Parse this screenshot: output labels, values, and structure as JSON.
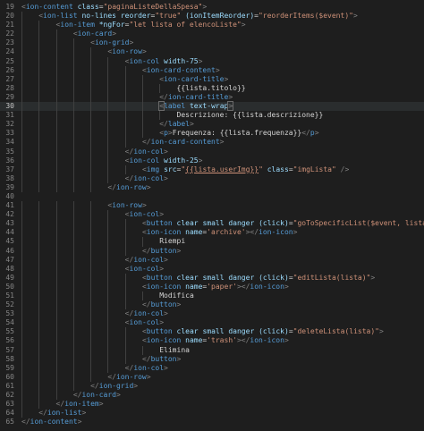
{
  "editor": {
    "language": "html",
    "active_line": 30,
    "colors": {
      "background": "#1e1e1e",
      "line_number": "#858585",
      "tag": "#569cd6",
      "attribute": "#9cdcfe",
      "string": "#ce9178",
      "text": "#d4d4d4",
      "punctuation": "#808080"
    },
    "lines": [
      {
        "n": "19",
        "indent": 0,
        "tokens": [
          [
            "p",
            "<"
          ],
          [
            "g",
            "ion-content"
          ],
          [
            "t",
            " "
          ],
          [
            "a",
            "class"
          ],
          [
            "t",
            "="
          ],
          [
            "s",
            "\"paginaListeDellaSpesa\""
          ],
          [
            "p",
            ">"
          ]
        ]
      },
      {
        "n": "20",
        "indent": 1,
        "tokens": [
          [
            "p",
            "<"
          ],
          [
            "g",
            "ion-list"
          ],
          [
            "t",
            " "
          ],
          [
            "a",
            "no-lines"
          ],
          [
            "t",
            " "
          ],
          [
            "a",
            "reorder"
          ],
          [
            "t",
            "="
          ],
          [
            "s",
            "\"true\""
          ],
          [
            "t",
            " "
          ],
          [
            "a",
            "(ionItemReorder)"
          ],
          [
            "t",
            "="
          ],
          [
            "s",
            "\"reorderItems($event)\""
          ],
          [
            "p",
            ">"
          ]
        ]
      },
      {
        "n": "21",
        "indent": 2,
        "tokens": [
          [
            "p",
            "<"
          ],
          [
            "g",
            "ion-item"
          ],
          [
            "t",
            " "
          ],
          [
            "a",
            "*ngFor"
          ],
          [
            "t",
            "="
          ],
          [
            "s",
            "\"let lista of elencoListe\""
          ],
          [
            "p",
            ">"
          ]
        ]
      },
      {
        "n": "22",
        "indent": 3,
        "tokens": [
          [
            "p",
            "<"
          ],
          [
            "g",
            "ion-card"
          ],
          [
            "p",
            ">"
          ]
        ]
      },
      {
        "n": "23",
        "indent": 4,
        "tokens": [
          [
            "p",
            "<"
          ],
          [
            "g",
            "ion-grid"
          ],
          [
            "p",
            ">"
          ]
        ]
      },
      {
        "n": "24",
        "indent": 5,
        "tokens": [
          [
            "p",
            "<"
          ],
          [
            "g",
            "ion-row"
          ],
          [
            "p",
            ">"
          ]
        ]
      },
      {
        "n": "25",
        "indent": 6,
        "tokens": [
          [
            "p",
            "<"
          ],
          [
            "g",
            "ion-col"
          ],
          [
            "t",
            " "
          ],
          [
            "a",
            "width-75"
          ],
          [
            "p",
            ">"
          ]
        ]
      },
      {
        "n": "26",
        "indent": 7,
        "tokens": [
          [
            "p",
            "<"
          ],
          [
            "g",
            "ion-card-content"
          ],
          [
            "p",
            ">"
          ]
        ]
      },
      {
        "n": "27",
        "indent": 8,
        "tokens": [
          [
            "p",
            "<"
          ],
          [
            "g",
            "ion-card-title"
          ],
          [
            "p",
            ">"
          ]
        ]
      },
      {
        "n": "28",
        "indent": 9,
        "tokens": [
          [
            "t",
            "{{lista.titolo}}"
          ]
        ]
      },
      {
        "n": "29",
        "indent": 8,
        "tokens": [
          [
            "p",
            "</"
          ],
          [
            "g",
            "ion-card-title"
          ],
          [
            "p",
            ">"
          ]
        ]
      },
      {
        "n": "30",
        "indent": 8,
        "tokens": [
          [
            "ph",
            "<"
          ],
          [
            "g",
            "label"
          ],
          [
            "t",
            " "
          ],
          [
            "a",
            "text-wrap"
          ],
          [
            "ph",
            ">"
          ]
        ]
      },
      {
        "n": "31",
        "indent": 9,
        "tokens": [
          [
            "t",
            "Descrizione: {{lista.descrizione}}"
          ]
        ]
      },
      {
        "n": "32",
        "indent": 8,
        "tokens": [
          [
            "p",
            "</"
          ],
          [
            "g",
            "label"
          ],
          [
            "p",
            ">"
          ]
        ]
      },
      {
        "n": "33",
        "indent": 8,
        "tokens": [
          [
            "p",
            "<"
          ],
          [
            "g",
            "p"
          ],
          [
            "p",
            ">"
          ],
          [
            "t",
            "Frequenza: {{lista.frequenza}}"
          ],
          [
            "p",
            "</"
          ],
          [
            "g",
            "p"
          ],
          [
            "p",
            ">"
          ]
        ]
      },
      {
        "n": "34",
        "indent": 7,
        "tokens": [
          [
            "p",
            "</"
          ],
          [
            "g",
            "ion-card-content"
          ],
          [
            "p",
            ">"
          ]
        ]
      },
      {
        "n": "35",
        "indent": 6,
        "tokens": [
          [
            "p",
            "</"
          ],
          [
            "g",
            "ion-col"
          ],
          [
            "p",
            ">"
          ]
        ]
      },
      {
        "n": "36",
        "indent": 6,
        "tokens": [
          [
            "p",
            "<"
          ],
          [
            "g",
            "ion-col"
          ],
          [
            "t",
            " "
          ],
          [
            "a",
            "width-25"
          ],
          [
            "p",
            ">"
          ]
        ]
      },
      {
        "n": "37",
        "indent": 7,
        "tokens": [
          [
            "p",
            "<"
          ],
          [
            "g",
            "img"
          ],
          [
            "t",
            " "
          ],
          [
            "a",
            "src"
          ],
          [
            "t",
            "="
          ],
          [
            "s",
            "\""
          ],
          [
            "l",
            "{{lista.userImg}}"
          ],
          [
            "s",
            "\""
          ],
          [
            "t",
            " "
          ],
          [
            "a",
            "class"
          ],
          [
            "t",
            "="
          ],
          [
            "s",
            "\"imgLista\""
          ],
          [
            "t",
            " "
          ],
          [
            "p",
            "/>"
          ]
        ]
      },
      {
        "n": "38",
        "indent": 6,
        "tokens": [
          [
            "p",
            "</"
          ],
          [
            "g",
            "ion-col"
          ],
          [
            "p",
            ">"
          ]
        ]
      },
      {
        "n": "39",
        "indent": 5,
        "tokens": [
          [
            "p",
            "</"
          ],
          [
            "g",
            "ion-row"
          ],
          [
            "p",
            ">"
          ]
        ]
      },
      {
        "n": "40",
        "indent": 0,
        "tokens": []
      },
      {
        "n": "41",
        "indent": 5,
        "tokens": [
          [
            "p",
            "<"
          ],
          [
            "g",
            "ion-row"
          ],
          [
            "p",
            ">"
          ]
        ]
      },
      {
        "n": "42",
        "indent": 6,
        "tokens": [
          [
            "p",
            "<"
          ],
          [
            "g",
            "ion-col"
          ],
          [
            "p",
            ">"
          ]
        ]
      },
      {
        "n": "43",
        "indent": 7,
        "tokens": [
          [
            "p",
            "<"
          ],
          [
            "g",
            "button"
          ],
          [
            "t",
            " "
          ],
          [
            "a",
            "clear"
          ],
          [
            "t",
            " "
          ],
          [
            "a",
            "small"
          ],
          [
            "t",
            " "
          ],
          [
            "a",
            "danger"
          ],
          [
            "t",
            " "
          ],
          [
            "a",
            "(click)"
          ],
          [
            "t",
            "="
          ],
          [
            "s",
            "\"goToSpecificList($event, lista.titolo)\""
          ],
          [
            "p",
            ">"
          ]
        ]
      },
      {
        "n": "44",
        "indent": 7,
        "tokens": [
          [
            "p",
            "<"
          ],
          [
            "g",
            "ion-icon"
          ],
          [
            "t",
            " "
          ],
          [
            "a",
            "name"
          ],
          [
            "t",
            "="
          ],
          [
            "s",
            "'archive'"
          ],
          [
            "p",
            "></"
          ],
          [
            "g",
            "ion-icon"
          ],
          [
            "p",
            ">"
          ]
        ]
      },
      {
        "n": "45",
        "indent": 8,
        "tokens": [
          [
            "t",
            "Riempi"
          ]
        ]
      },
      {
        "n": "46",
        "indent": 7,
        "tokens": [
          [
            "p",
            "</"
          ],
          [
            "g",
            "button"
          ],
          [
            "p",
            ">"
          ]
        ]
      },
      {
        "n": "47",
        "indent": 6,
        "tokens": [
          [
            "p",
            "</"
          ],
          [
            "g",
            "ion-col"
          ],
          [
            "p",
            ">"
          ]
        ]
      },
      {
        "n": "48",
        "indent": 6,
        "tokens": [
          [
            "p",
            "<"
          ],
          [
            "g",
            "ion-col"
          ],
          [
            "p",
            ">"
          ]
        ]
      },
      {
        "n": "49",
        "indent": 7,
        "tokens": [
          [
            "p",
            "<"
          ],
          [
            "g",
            "button"
          ],
          [
            "t",
            " "
          ],
          [
            "a",
            "clear"
          ],
          [
            "t",
            " "
          ],
          [
            "a",
            "small"
          ],
          [
            "t",
            " "
          ],
          [
            "a",
            "danger"
          ],
          [
            "t",
            " "
          ],
          [
            "a",
            "(click)"
          ],
          [
            "t",
            "="
          ],
          [
            "s",
            "\"editLista(lista)\""
          ],
          [
            "p",
            ">"
          ]
        ]
      },
      {
        "n": "50",
        "indent": 7,
        "tokens": [
          [
            "p",
            "<"
          ],
          [
            "g",
            "ion-icon"
          ],
          [
            "t",
            " "
          ],
          [
            "a",
            "name"
          ],
          [
            "t",
            "="
          ],
          [
            "s",
            "'paper'"
          ],
          [
            "p",
            "></"
          ],
          [
            "g",
            "ion-icon"
          ],
          [
            "p",
            ">"
          ]
        ]
      },
      {
        "n": "51",
        "indent": 8,
        "tokens": [
          [
            "t",
            "Modifica"
          ]
        ]
      },
      {
        "n": "52",
        "indent": 7,
        "tokens": [
          [
            "p",
            "</"
          ],
          [
            "g",
            "button"
          ],
          [
            "p",
            ">"
          ]
        ]
      },
      {
        "n": "53",
        "indent": 6,
        "tokens": [
          [
            "p",
            "</"
          ],
          [
            "g",
            "ion-col"
          ],
          [
            "p",
            ">"
          ]
        ]
      },
      {
        "n": "54",
        "indent": 6,
        "tokens": [
          [
            "p",
            "<"
          ],
          [
            "g",
            "ion-col"
          ],
          [
            "p",
            ">"
          ]
        ]
      },
      {
        "n": "55",
        "indent": 7,
        "tokens": [
          [
            "p",
            "<"
          ],
          [
            "g",
            "button"
          ],
          [
            "t",
            " "
          ],
          [
            "a",
            "clear"
          ],
          [
            "t",
            " "
          ],
          [
            "a",
            "small"
          ],
          [
            "t",
            " "
          ],
          [
            "a",
            "danger"
          ],
          [
            "t",
            " "
          ],
          [
            "a",
            "(click)"
          ],
          [
            "t",
            "="
          ],
          [
            "s",
            "\"deleteLista(lista)\""
          ],
          [
            "p",
            ">"
          ]
        ]
      },
      {
        "n": "56",
        "indent": 7,
        "tokens": [
          [
            "p",
            "<"
          ],
          [
            "g",
            "ion-icon"
          ],
          [
            "t",
            " "
          ],
          [
            "a",
            "name"
          ],
          [
            "t",
            "="
          ],
          [
            "s",
            "'trash'"
          ],
          [
            "p",
            "></"
          ],
          [
            "g",
            "ion-icon"
          ],
          [
            "p",
            ">"
          ]
        ]
      },
      {
        "n": "57",
        "indent": 8,
        "tokens": [
          [
            "t",
            "Elimina"
          ]
        ]
      },
      {
        "n": "58",
        "indent": 7,
        "tokens": [
          [
            "p",
            "</"
          ],
          [
            "g",
            "button"
          ],
          [
            "p",
            ">"
          ]
        ]
      },
      {
        "n": "59",
        "indent": 6,
        "tokens": [
          [
            "p",
            "</"
          ],
          [
            "g",
            "ion-col"
          ],
          [
            "p",
            ">"
          ]
        ]
      },
      {
        "n": "60",
        "indent": 5,
        "tokens": [
          [
            "p",
            "</"
          ],
          [
            "g",
            "ion-row"
          ],
          [
            "p",
            ">"
          ]
        ]
      },
      {
        "n": "61",
        "indent": 4,
        "tokens": [
          [
            "p",
            "</"
          ],
          [
            "g",
            "ion-grid"
          ],
          [
            "p",
            ">"
          ]
        ]
      },
      {
        "n": "62",
        "indent": 3,
        "tokens": [
          [
            "p",
            "</"
          ],
          [
            "g",
            "ion-card"
          ],
          [
            "p",
            ">"
          ]
        ]
      },
      {
        "n": "63",
        "indent": 2,
        "tokens": [
          [
            "p",
            "</"
          ],
          [
            "g",
            "ion-item"
          ],
          [
            "p",
            ">"
          ]
        ]
      },
      {
        "n": "64",
        "indent": 1,
        "tokens": [
          [
            "p",
            "</"
          ],
          [
            "g",
            "ion-list"
          ],
          [
            "p",
            ">"
          ]
        ]
      },
      {
        "n": "65",
        "indent": 0,
        "tokens": [
          [
            "p",
            "</"
          ],
          [
            "g",
            "ion-content"
          ],
          [
            "p",
            ">"
          ]
        ]
      }
    ]
  }
}
